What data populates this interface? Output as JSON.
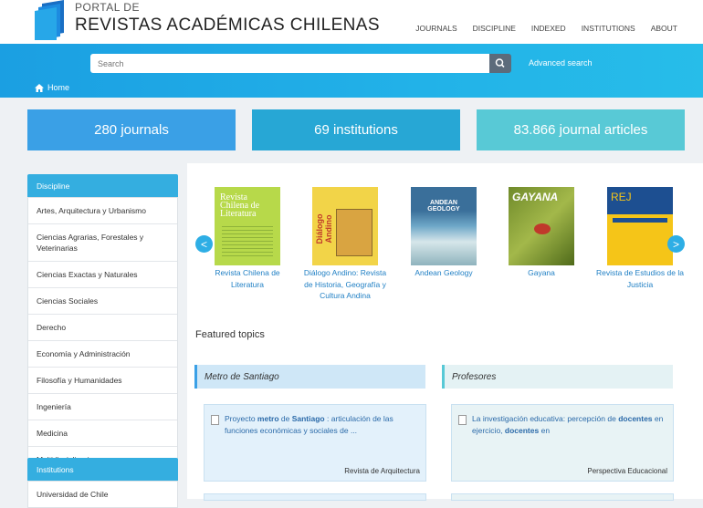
{
  "header": {
    "portal_small": "PORTAL DE",
    "portal_big": "REVISTAS ACADÉMICAS CHILENAS",
    "nav": [
      "JOURNALS",
      "DISCIPLINE",
      "INDEXED",
      "INSTITUTIONS",
      "ABOUT"
    ]
  },
  "search": {
    "placeholder": "Search",
    "advanced": "Advanced search"
  },
  "breadcrumb": {
    "home": "Home"
  },
  "stats": {
    "journals": "280 journals",
    "institutions": "69 institutions",
    "articles": "83.866 journal articles"
  },
  "sidebar": {
    "discipline_title": "Discipline",
    "disciplines": [
      "Artes, Arquitectura y Urbanismo",
      "Ciencias Agrarias, Forestales y Veterinarias",
      "Ciencias Exactas y Naturales",
      "Ciencias Sociales",
      "Derecho",
      "Economía y Administración",
      "Filosofía y Humanidades",
      "Ingeniería",
      "Medicina",
      "Multidisciplinarias"
    ],
    "institutions_title": "Institutions",
    "institutions": [
      "Universidad de Chile"
    ]
  },
  "carousel": {
    "prev": "<",
    "next": ">",
    "journals": [
      {
        "title": "Revista Chilena de Literatura",
        "cover_text": "Revista Chilena de Literatura"
      },
      {
        "title": "Diálogo Andino: Revista de Historia, Geografía y Cultura Andina",
        "cover_text": "Diálogo Andino"
      },
      {
        "title": "Andean Geology",
        "cover_text": "ANDEAN GEOLOGY"
      },
      {
        "title": "Gayana",
        "cover_text": "GAYANA"
      },
      {
        "title": "Revista de Estudios de la Justicia",
        "cover_text": "REJ"
      }
    ]
  },
  "featured": {
    "title": "Featured topics",
    "topics": [
      {
        "name": "Metro de Santiago",
        "article_parts": [
          "Proyecto ",
          "metro",
          " de ",
          "Santiago",
          " : articulación de las funciones económicas y sociales de ..."
        ],
        "journal": "Revista de Arquitectura"
      },
      {
        "name": "Profesores",
        "article_parts": [
          "La investigación educativa: percepción de ",
          "docentes",
          " en ejercicio, ",
          "docentes",
          " en"
        ],
        "journal": "Perspectiva Educacional"
      }
    ]
  },
  "colors": {
    "banner": "#22b2e8",
    "stat_journals": "#3aa0e6",
    "stat_institutions": "#27a7d5",
    "stat_articles": "#58c9d6",
    "link": "#1f7fc4"
  },
  "icons": [
    "logo-icon",
    "search-icon",
    "home-icon",
    "document-icon",
    "chevron-left-icon",
    "chevron-right-icon"
  ]
}
